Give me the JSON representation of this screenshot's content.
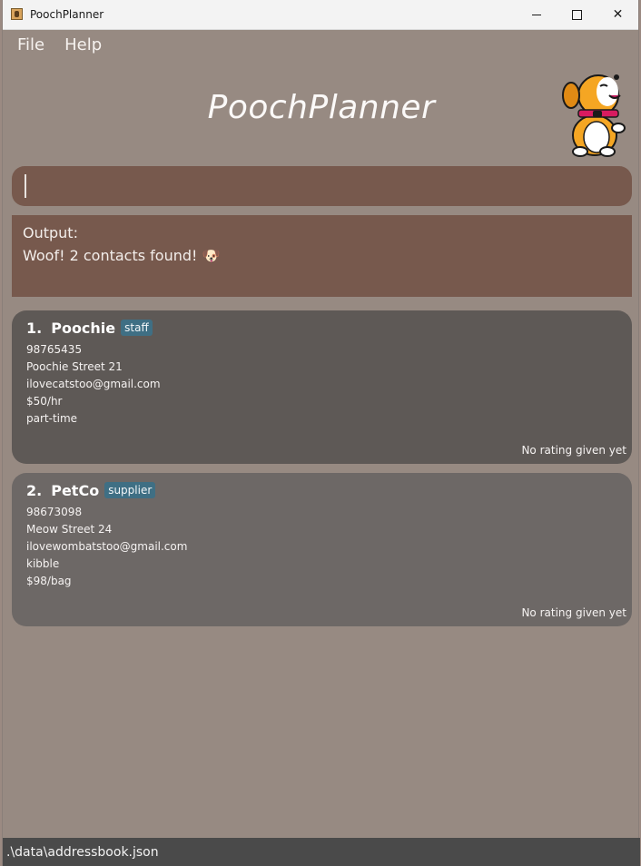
{
  "window": {
    "title": "PoochPlanner"
  },
  "menu": {
    "file": "File",
    "help": "Help"
  },
  "header": {
    "title": "PoochPlanner"
  },
  "command": {
    "value": ""
  },
  "output": {
    "label": "Output:",
    "message": "Woof! 2 contacts found! 🐶"
  },
  "contacts": [
    {
      "index": "1.",
      "name": "Poochie",
      "tag": "staff",
      "phone": "98765435",
      "address": "Poochie Street 21",
      "email": "ilovecatstoo@gmail.com",
      "rate": "$50/hr",
      "detail": "part-time",
      "rating": "No rating given yet"
    },
    {
      "index": "2.",
      "name": "PetCo",
      "tag": "supplier",
      "phone": "98673098",
      "address": "Meow Street 24",
      "email": "ilovewombatstoo@gmail.com",
      "rate": "kibble",
      "detail": "$98/bag",
      "rating": "No rating given yet"
    }
  ],
  "status": {
    "path": ".\\data\\addressbook.json"
  },
  "colors": {
    "background": "#978a82",
    "panel": "#77594d",
    "card1": "#5e5956",
    "card2": "#6d6866",
    "tag": "#3f6f84",
    "statusbar": "#4a4a4a"
  }
}
